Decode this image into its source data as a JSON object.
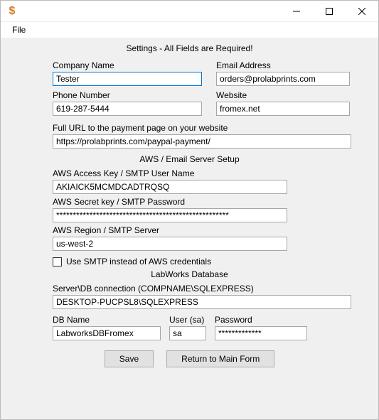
{
  "titlebar": {
    "icon_char": "$",
    "minimize_glyph": "—",
    "maximize_glyph": "▢",
    "close_glyph": "✕"
  },
  "menubar": {
    "file": "File"
  },
  "headings": {
    "main": "Settings - All Fields are Required!",
    "aws": "AWS / Email Server Setup",
    "db": "LabWorks Database"
  },
  "company": {
    "name_label": "Company Name",
    "name_value": "Tester",
    "phone_label": "Phone Number",
    "phone_value": "619-287-5444"
  },
  "contact": {
    "email_label": "Email Address",
    "email_value": "orders@prolabprints.com",
    "website_label": "Website",
    "website_value": "fromex.net"
  },
  "payment": {
    "label": "Full URL to the payment page on your website",
    "value": "https://prolabprints.com/paypal-payment/"
  },
  "aws": {
    "access_label": "AWS Access Key / SMTP User Name",
    "access_value": "AKIAICK5MCMDCADTRQSQ",
    "secret_label": "AWS Secret key / SMTP Password",
    "secret_value": "****************************************************",
    "region_label": "AWS Region / SMTP Server",
    "region_value": "us-west-2",
    "use_smtp_label": "Use SMTP instead of AWS credentials"
  },
  "db": {
    "conn_label": "Server\\DB connection (COMPNAME\\SQLEXPRESS)",
    "conn_value": "DESKTOP-PUCPSL8\\SQLEXPRESS",
    "name_label": "DB Name",
    "name_value": "LabworksDBFromex",
    "user_label": "User (sa)",
    "user_value": "sa",
    "pw_label": "Password",
    "pw_value": "*************"
  },
  "buttons": {
    "save": "Save",
    "return": "Return to Main Form"
  }
}
